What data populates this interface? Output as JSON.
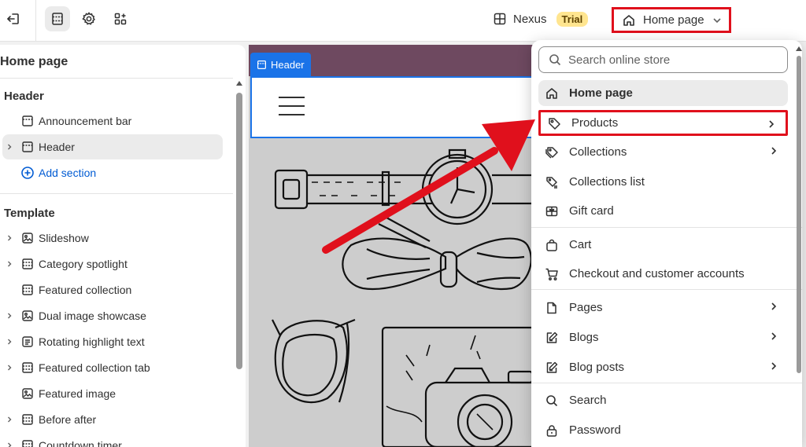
{
  "topbar": {
    "store_name": "Nexus",
    "trial_badge": "Trial",
    "page_selector": "Home page"
  },
  "sidebar": {
    "title": "Home page",
    "header_group": {
      "heading": "Header",
      "items": [
        {
          "label": "Announcement bar"
        },
        {
          "label": "Header"
        }
      ],
      "add_section": "Add section"
    },
    "template_group": {
      "heading": "Template",
      "items": [
        {
          "label": "Slideshow"
        },
        {
          "label": "Category spotlight"
        },
        {
          "label": "Featured collection"
        },
        {
          "label": "Dual image showcase"
        },
        {
          "label": "Rotating highlight text"
        },
        {
          "label": "Featured collection tab"
        },
        {
          "label": "Featured image"
        },
        {
          "label": "Before after"
        },
        {
          "label": "Countdown timer"
        }
      ]
    }
  },
  "preview": {
    "header_tag": "Header"
  },
  "dropdown": {
    "search_placeholder": "Search online store",
    "items": [
      {
        "label": "Home page"
      },
      {
        "label": "Products"
      },
      {
        "label": "Collections"
      },
      {
        "label": "Collections list"
      },
      {
        "label": "Gift card"
      },
      {
        "label": "Cart"
      },
      {
        "label": "Checkout and customer accounts"
      },
      {
        "label": "Pages"
      },
      {
        "label": "Blogs"
      },
      {
        "label": "Blog posts"
      },
      {
        "label": "Search"
      },
      {
        "label": "Password"
      }
    ]
  },
  "colors": {
    "highlight_red": "#e0101c",
    "accent_blue": "#1a73e8",
    "link_blue": "#005bd3",
    "announcement_bar": "#6e4960",
    "trial_badge_bg": "#ffe58f"
  }
}
